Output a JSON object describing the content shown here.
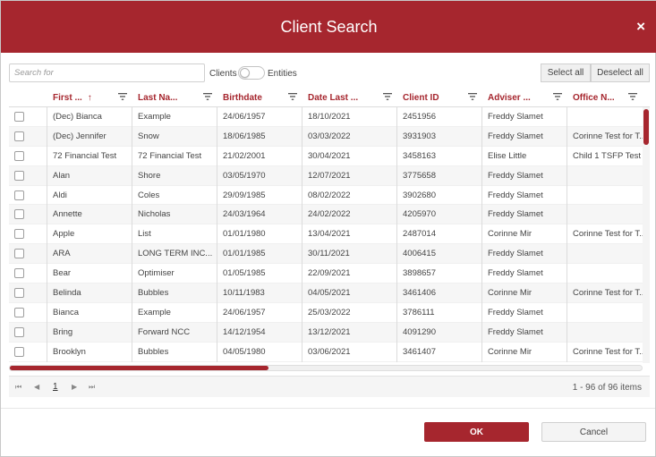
{
  "dialog": {
    "title": "Client Search",
    "close_glyph": "×",
    "close_icon": "close-icon"
  },
  "toolbar": {
    "search_placeholder": "Search for",
    "search_value": "",
    "toggle_left": "Clients",
    "toggle_right": "Entities",
    "select_all": "Select all",
    "deselect_all": "Deselect all"
  },
  "columns": [
    {
      "label": "First ...",
      "sorted": "ascending"
    },
    {
      "label": "Last Na..."
    },
    {
      "label": "Birthdate"
    },
    {
      "label": "Date Last ..."
    },
    {
      "label": "Client ID"
    },
    {
      "label": "Adviser ..."
    },
    {
      "label": "Office N..."
    }
  ],
  "sort_glyph": "↑",
  "rows": [
    [
      "(Dec) Bianca",
      "Example",
      "24/06/1957",
      "18/10/2021",
      "2451956",
      "Freddy Slamet",
      ""
    ],
    [
      "(Dec) Jennifer",
      "Snow",
      "18/06/1985",
      "03/03/2022",
      "3931903",
      "Freddy Slamet",
      "Corinne Test for T..."
    ],
    [
      "72 Financial Test",
      "72 Financial Test",
      "21/02/2001",
      "30/04/2021",
      "3458163",
      "Elise Little",
      "Child 1 TSFP Test"
    ],
    [
      "Alan",
      "Shore",
      "03/05/1970",
      "12/07/2021",
      "3775658",
      "Freddy Slamet",
      ""
    ],
    [
      "Aldi",
      "Coles",
      "29/09/1985",
      "08/02/2022",
      "3902680",
      "Freddy Slamet",
      ""
    ],
    [
      "Annette",
      "Nicholas",
      "24/03/1964",
      "24/02/2022",
      "4205970",
      "Freddy Slamet",
      ""
    ],
    [
      "Apple",
      "List",
      "01/01/1980",
      "13/04/2021",
      "2487014",
      "Corinne Mir",
      "Corinne Test for T..."
    ],
    [
      "ARA",
      "LONG TERM INC...",
      "01/01/1985",
      "30/11/2021",
      "4006415",
      "Freddy Slamet",
      ""
    ],
    [
      "Bear",
      "Optimiser",
      "01/05/1985",
      "22/09/2021",
      "3898657",
      "Freddy Slamet",
      ""
    ],
    [
      "Belinda",
      "Bubbles",
      "10/11/1983",
      "04/05/2021",
      "3461406",
      "Corinne Mir",
      "Corinne Test for T..."
    ],
    [
      "Bianca",
      "Example",
      "24/06/1957",
      "25/03/2022",
      "3786111",
      "Freddy Slamet",
      ""
    ],
    [
      "Bring",
      "Forward NCC",
      "14/12/1954",
      "13/12/2021",
      "4091290",
      "Freddy Slamet",
      ""
    ],
    [
      "Brooklyn",
      "Bubbles",
      "04/05/1980",
      "03/06/2021",
      "3461407",
      "Corinne Mir",
      "Corinne Test for T..."
    ]
  ],
  "pager": {
    "first_glyph": "⏮",
    "prev_glyph": "◀",
    "next_glyph": "▶",
    "last_glyph": "⏭",
    "current_page": "1",
    "info": "1 - 96 of 96 items"
  },
  "scroll": {
    "horizontal_fraction": 0.41
  },
  "footer": {
    "ok": "OK",
    "cancel": "Cancel"
  },
  "colors": {
    "brand": "#a6262e",
    "header_text": "#a6262e"
  }
}
